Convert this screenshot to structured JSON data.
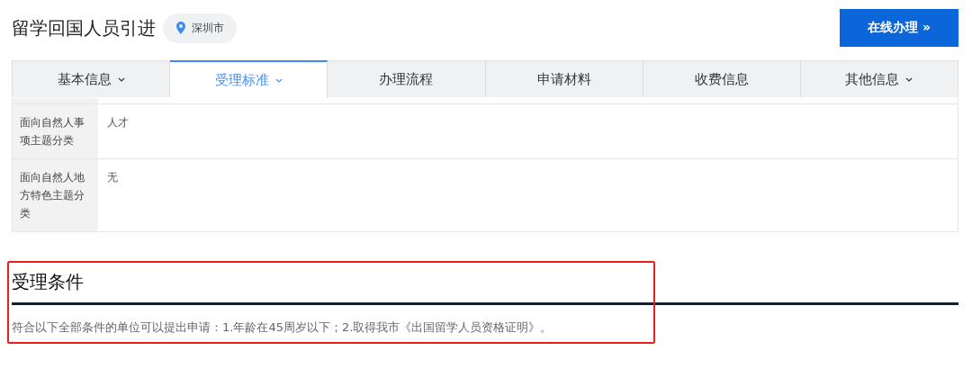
{
  "header": {
    "title": "留学回国人员引进",
    "location": "深圳市",
    "action_button": "在线办理 »"
  },
  "tabs": [
    {
      "label": "基本信息",
      "selected": false,
      "dropdown": true
    },
    {
      "label": "受理标准",
      "selected": true,
      "dropdown": true
    },
    {
      "label": "办理流程",
      "selected": false,
      "dropdown": false
    },
    {
      "label": "申请材料",
      "selected": false,
      "dropdown": false
    },
    {
      "label": "收费信息",
      "selected": false,
      "dropdown": false
    },
    {
      "label": "其他信息",
      "selected": false,
      "dropdown": true
    }
  ],
  "info_table": {
    "rows": [
      {
        "label": "面向自然人事项主题分类",
        "value": "人才"
      },
      {
        "label": "面向自然人地方特色主题分类",
        "value": "无"
      }
    ]
  },
  "section": {
    "title": "受理条件",
    "text": "符合以下全部条件的单位可以提出申请：1.年龄在45周岁以下；2.取得我市《出国留学人员资格证明》。",
    "highlighted": true
  }
}
